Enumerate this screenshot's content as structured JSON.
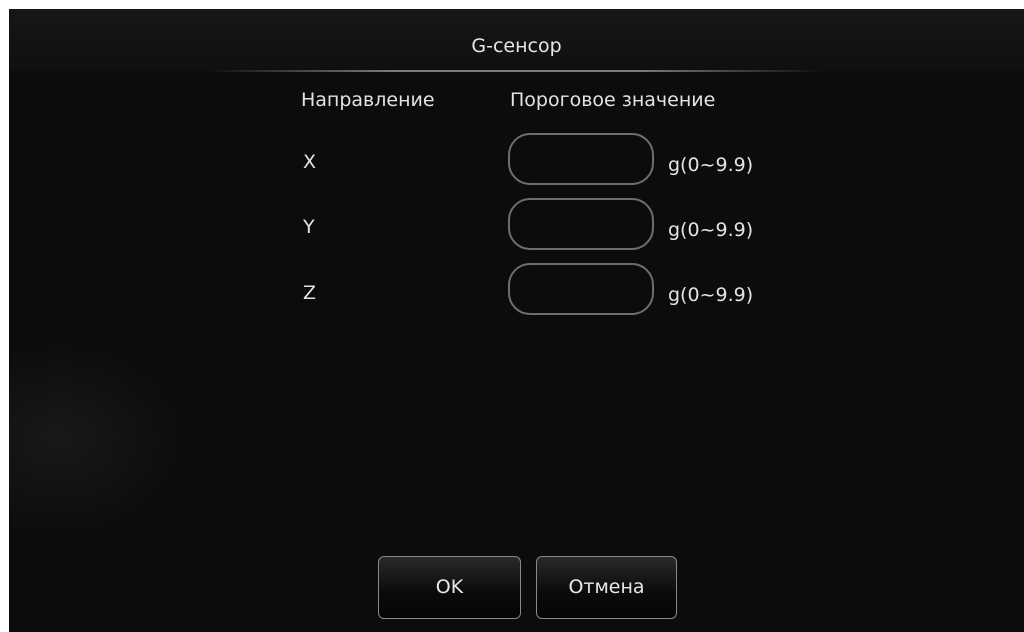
{
  "dialog": {
    "title": "G-сенсор",
    "headers": {
      "direction": "Направление",
      "threshold": "Пороговое значение"
    },
    "axes": [
      {
        "label": "X",
        "value": "",
        "unit": "g(0~9.9)"
      },
      {
        "label": "Y",
        "value": "",
        "unit": "g(0~9.9)"
      },
      {
        "label": "Z",
        "value": "",
        "unit": "g(0~9.9)"
      }
    ],
    "buttons": {
      "ok": "OK",
      "cancel": "Отмена"
    }
  }
}
